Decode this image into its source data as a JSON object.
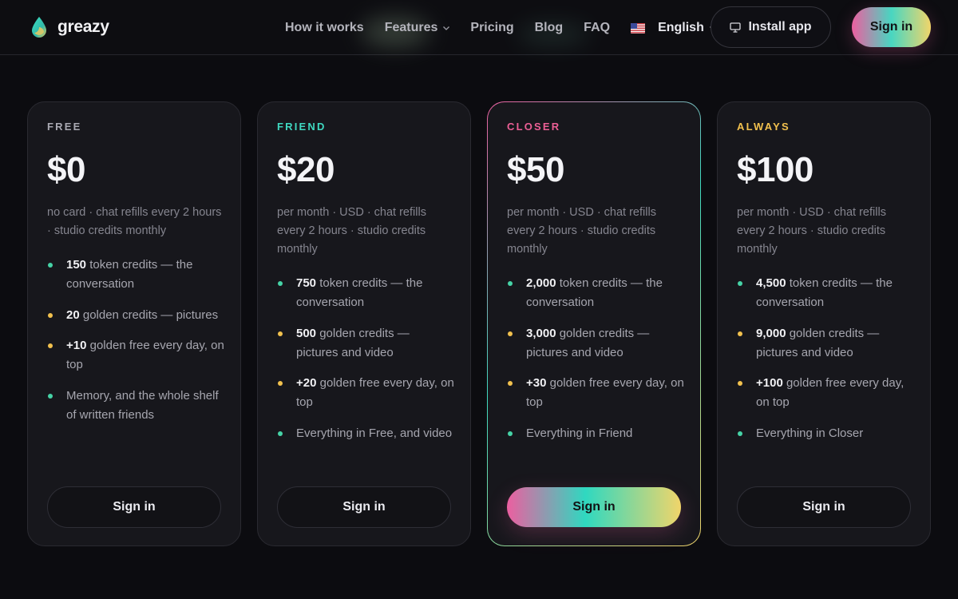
{
  "brand": {
    "name": "greazy"
  },
  "nav": {
    "items": [
      "How it works",
      "Features",
      "Pricing",
      "Blog",
      "FAQ"
    ],
    "language": "English",
    "install_label": "Install app",
    "signin_label": "Sign in"
  },
  "plans": [
    {
      "tier": "FREE",
      "tier_color": "#a9a9b2",
      "price": "$0",
      "subtitle": "no card · chat refills every 2 hours · studio credits monthly",
      "features": [
        {
          "bold": "150",
          "text": " token credits — the conversation",
          "dot": "#46d3a6"
        },
        {
          "bold": "20",
          "text": " golden credits — pictures",
          "dot": "#f2c14e"
        },
        {
          "bold": "+10",
          "text": " golden free every day, on top",
          "dot": "#f2c14e"
        },
        {
          "bold": "",
          "text": "Memory, and the whole shelf of written friends",
          "dot": "#46d3a6"
        }
      ],
      "button": "Sign in"
    },
    {
      "tier": "FRIEND",
      "tier_color": "#3fd8c0",
      "price": "$20",
      "subtitle": "per month · USD · chat refills every 2 hours · studio credits monthly",
      "features": [
        {
          "bold": "750",
          "text": " token credits — the conversation",
          "dot": "#46d3a6"
        },
        {
          "bold": "500",
          "text": " golden credits — pictures and video",
          "dot": "#f2c14e"
        },
        {
          "bold": "+20",
          "text": " golden free every day, on top",
          "dot": "#f2c14e"
        },
        {
          "bold": "",
          "text": "Everything in Free, and video",
          "dot": "#46d3a6"
        }
      ],
      "button": "Sign in"
    },
    {
      "tier": "CLOSER",
      "tier_color": "#ec5f95",
      "price": "$50",
      "subtitle": "per month · USD · chat refills every 2 hours · studio credits monthly",
      "features": [
        {
          "bold": "2,000",
          "text": " token credits — the conversation",
          "dot": "#46d3a6"
        },
        {
          "bold": "3,000",
          "text": " golden credits — pictures and video",
          "dot": "#f2c14e"
        },
        {
          "bold": "+30",
          "text": " golden free every day, on top",
          "dot": "#f2c14e"
        },
        {
          "bold": "",
          "text": "Everything in Friend",
          "dot": "#46d3a6"
        }
      ],
      "button": "Sign in"
    },
    {
      "tier": "ALWAYS",
      "tier_color": "#f2c14e",
      "price": "$100",
      "subtitle": "per month · USD · chat refills every 2 hours · studio credits monthly",
      "features": [
        {
          "bold": "4,500",
          "text": " token credits — the conversation",
          "dot": "#46d3a6"
        },
        {
          "bold": "9,000",
          "text": " golden credits — pictures and video",
          "dot": "#f2c14e"
        },
        {
          "bold": "+100",
          "text": " golden free every day, on top",
          "dot": "#f2c14e"
        },
        {
          "bold": "",
          "text": "Everything in Closer",
          "dot": "#46d3a6"
        }
      ],
      "button": "Sign in"
    }
  ]
}
